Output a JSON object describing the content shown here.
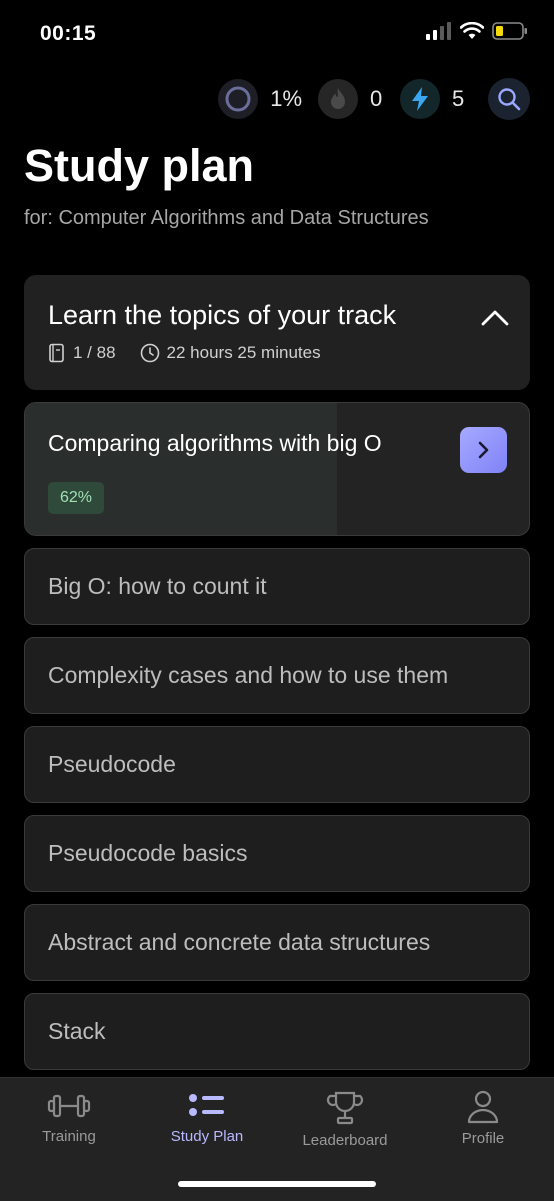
{
  "status_bar": {
    "time": "00:15",
    "battery_color": "#f5d90a"
  },
  "stats": {
    "progress_value": "1%",
    "streak_value": "0",
    "energy_value": "5",
    "energy_color": "#3aa7f0"
  },
  "header": {
    "title": "Study plan",
    "subtitle": "for: Computer Algorithms and Data Structures"
  },
  "section": {
    "title": "Learn the topics of your track",
    "topics_count": "1 / 88",
    "duration": "22 hours 25 minutes",
    "expanded": true
  },
  "current_topic": {
    "title": "Comparing algorithms with big O",
    "progress_label": "62%",
    "progress_fraction": 0.62,
    "accent": "#8f92fb"
  },
  "topics": [
    {
      "label": "Big O: how to count it"
    },
    {
      "label": "Complexity cases and how to use them"
    },
    {
      "label": "Pseudocode"
    },
    {
      "label": "Pseudocode basics"
    },
    {
      "label": "Abstract and concrete data structures"
    },
    {
      "label": "Stack"
    }
  ],
  "tab_bar": {
    "active": "Study Plan",
    "tabs": [
      {
        "label": "Training",
        "icon": "dumbbell-icon"
      },
      {
        "label": "Study Plan",
        "icon": "list-icon"
      },
      {
        "label": "Leaderboard",
        "icon": "trophy-icon"
      },
      {
        "label": "Profile",
        "icon": "person-icon"
      }
    ]
  }
}
